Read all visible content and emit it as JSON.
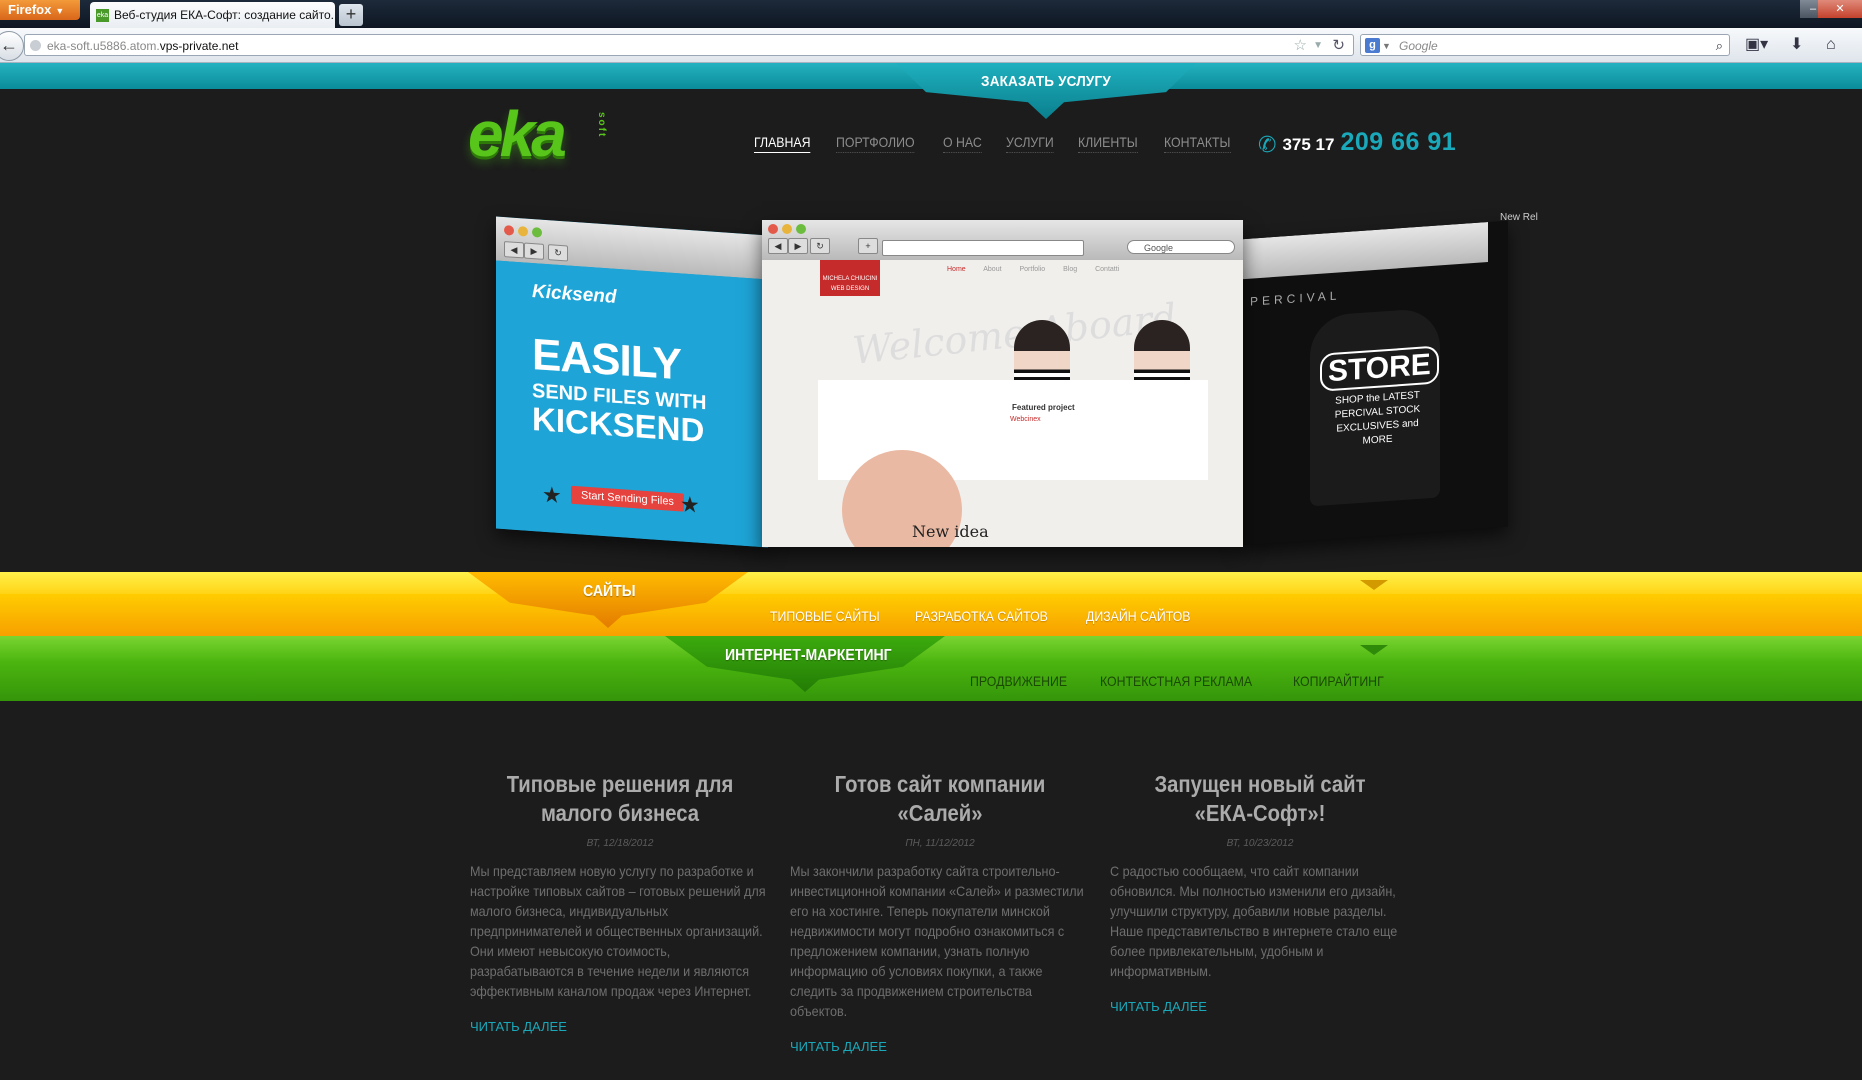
{
  "browser": {
    "app_button": "Firefox",
    "tab_title": "Веб-студия ЕКА-Софт: создание сайто...",
    "new_tab": "+",
    "url_prefix": "eka-soft.u5886.atom.",
    "url_host": "vps-private.net",
    "search_placeholder": "Google"
  },
  "site": {
    "order_button": "ЗАКАЗАТЬ УСЛУГУ",
    "logo_text": "eka",
    "logo_sub": "soft",
    "nav": [
      "ГЛАВНАЯ",
      "ПОРТФОЛИО",
      "О НАС",
      "УСЛУГИ",
      "КЛИЕНТЫ",
      "КОНТАКТЫ"
    ],
    "nav_active": "ГЛАВНАЯ",
    "phone_code": "375 17",
    "phone_number": "209 66 91"
  },
  "slider": {
    "left": {
      "brand": "Kicksend",
      "line1": "EASILY",
      "line2": "SEND FILES WITH",
      "line3": "KICKSEND",
      "button": "Start Sending Files"
    },
    "center": {
      "search": "Google",
      "logo": "MICHELA CHIUCINI WEB DESIGN",
      "nav": [
        "Home",
        "About",
        "Portfolio",
        "Blog",
        "Contatti"
      ],
      "welcome": "Welcome Aboard",
      "featured": "Featured project",
      "featured_sub": "Webcinex",
      "idea": "New idea"
    },
    "right": {
      "brand": "PERCIVAL",
      "store": "STORE",
      "tagline": "SHOP the LATEST PERCIVAL STOCK EXCLUSIVES and MORE",
      "corner": "New Rel"
    }
  },
  "services": {
    "sites": {
      "title": "САЙТЫ",
      "links": [
        "ТИПОВЫЕ САЙТЫ",
        "РАЗРАБОТКА САЙТОВ",
        "ДИЗАЙН САЙТОВ"
      ]
    },
    "marketing": {
      "title": "ИНТЕРНЕТ-МАРКЕТИНГ",
      "links": [
        "ПРОДВИЖЕНИЕ",
        "КОНТЕКСТНАЯ РЕКЛАМА",
        "КОПИРАЙТИНГ"
      ]
    }
  },
  "news": [
    {
      "title": "Типовые решения для малого бизнеса",
      "date": "ВТ, 12/18/2012",
      "text": "Мы представляем новую услугу по разработке и настройке типовых сайтов – готовых решений для малого бизнеса, индивидуальных предпринимателей и общественных организаций. Они имеют невысокую стоимость, разрабатываются в течение недели и являются эффективным каналом продаж через Интернет.",
      "more": "ЧИТАТЬ ДАЛЕЕ"
    },
    {
      "title": "Готов сайт компании «Салей»",
      "date": "ПН, 11/12/2012",
      "text": "Мы закончили разработку сайта строительно-инвестиционной компании «Салей» и разместили его на хостинге. Теперь покупатели минской недвижимости могут подробно ознакомиться с предложением компании, узнать полную информацию об условиях покупки, а также следить за продвижением строительства объектов.",
      "more": "ЧИТАТЬ ДАЛЕЕ"
    },
    {
      "title": "Запущен новый сайт «ЕКА-Софт»!",
      "date": "ВТ, 10/23/2012",
      "text": "С радостью сообщаем, что сайт компании обновился. Мы полностью изменили его дизайн, улучшили структуру, добавили новые разделы. Наше представительство в интернете стало еще более привлекательным, удобным и информативным.",
      "more": "ЧИТАТЬ ДАЛЕЕ"
    }
  ],
  "colors": {
    "teal": "#1aa9ba",
    "yellow": "#ffcc00",
    "green": "#4cb50f",
    "background": "#1c1c1c"
  }
}
